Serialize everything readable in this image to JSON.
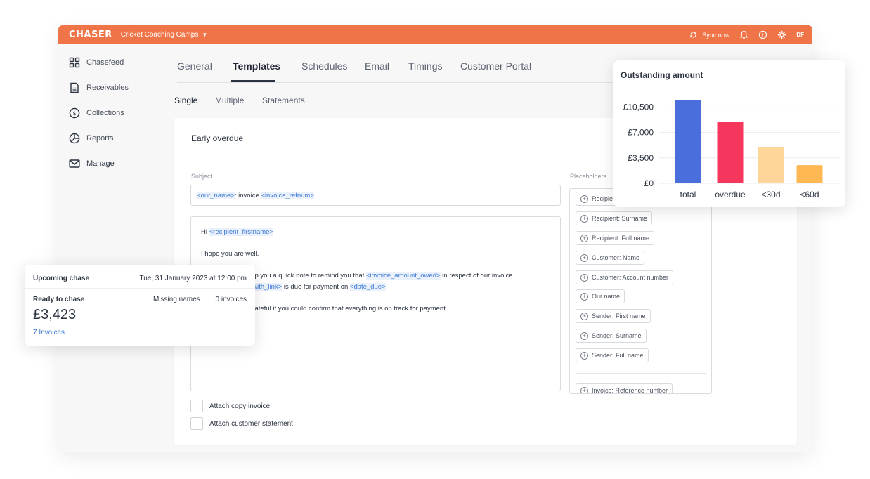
{
  "topbar": {
    "brand": "CHASER",
    "org_name": "Cricket Coaching Camps",
    "sync_label": "Sync now",
    "avatar_initials": "DF",
    "color": "#ef7549"
  },
  "sidebar": {
    "items": [
      {
        "label": "Chasefeed",
        "icon": "grid-icon"
      },
      {
        "label": "Receivables",
        "icon": "document-icon"
      },
      {
        "label": "Collections",
        "icon": "dollar-circle-icon"
      },
      {
        "label": "Reports",
        "icon": "pie-chart-icon"
      },
      {
        "label": "Manage",
        "icon": "envelope-icon",
        "active": true
      }
    ]
  },
  "tabs": [
    {
      "label": "General"
    },
    {
      "label": "Templates",
      "active": true
    },
    {
      "label": "Schedules"
    },
    {
      "label": "Email"
    },
    {
      "label": "Timings"
    },
    {
      "label": "Customer Portal"
    }
  ],
  "subtabs": [
    {
      "label": "Single",
      "active": true
    },
    {
      "label": "Multiple"
    },
    {
      "label": "Statements"
    }
  ],
  "template": {
    "name": "Early overdue",
    "subject_label": "Subject",
    "subject": {
      "ph1": "<our_name>",
      "text1": ": invoice ",
      "ph2": "<invoice_refnum>"
    },
    "body": {
      "greeting": "Hi ",
      "greeting_ph": "<recipient_firstname>",
      "line1": "I hope you are well.",
      "line2_text": "rop you a quick note to remind you that ",
      "line2_ph": "<invoice_amount_owed>",
      "line2_text2": " in respect of our invoice",
      "line3_ph": "_with_link>",
      "line3_text": " is due for payment on ",
      "line3_ph2": "<date_due>",
      "line4_text": "grateful if you could confirm that everything is on track for payment."
    },
    "placeholders_label": "Placeholders",
    "placeholders": [
      "Recipient",
      "Recipient: Surname",
      "Recipient: Full name",
      "Customer: Name",
      "Customer: Account number",
      "Our name",
      "Sender: First name",
      "Sender: Surname",
      "Sender: Full name",
      "Invoice: Reference number"
    ],
    "checkboxes": [
      {
        "label": "Attach copy invoice",
        "checked": false
      },
      {
        "label": "Attach customer statement",
        "checked": false
      }
    ]
  },
  "upcoming": {
    "title": "Upcoming chase",
    "date": "Tue, 31 January 2023 at 12:00 pm",
    "ready_label": "Ready to chase",
    "missing_label": "Missing names",
    "missing_value": "0 invoices",
    "amount": "£3,423",
    "invoices_link": "7 Invoices"
  },
  "chart_data": {
    "type": "bar",
    "title": "Outstanding amount",
    "categories": [
      "total",
      "overdue",
      "<30d",
      "<60d"
    ],
    "values": [
      11500,
      8500,
      5000,
      2500
    ],
    "colors": [
      "#4a6fdc",
      "#f5375e",
      "#ffd699",
      "#ffb852"
    ],
    "yticks": [
      "£10,500",
      "£7,000",
      "£3,500",
      "£0"
    ],
    "ytick_values": [
      10500,
      7000,
      3500,
      0
    ],
    "ylim": [
      0,
      11500
    ],
    "grid": true
  }
}
